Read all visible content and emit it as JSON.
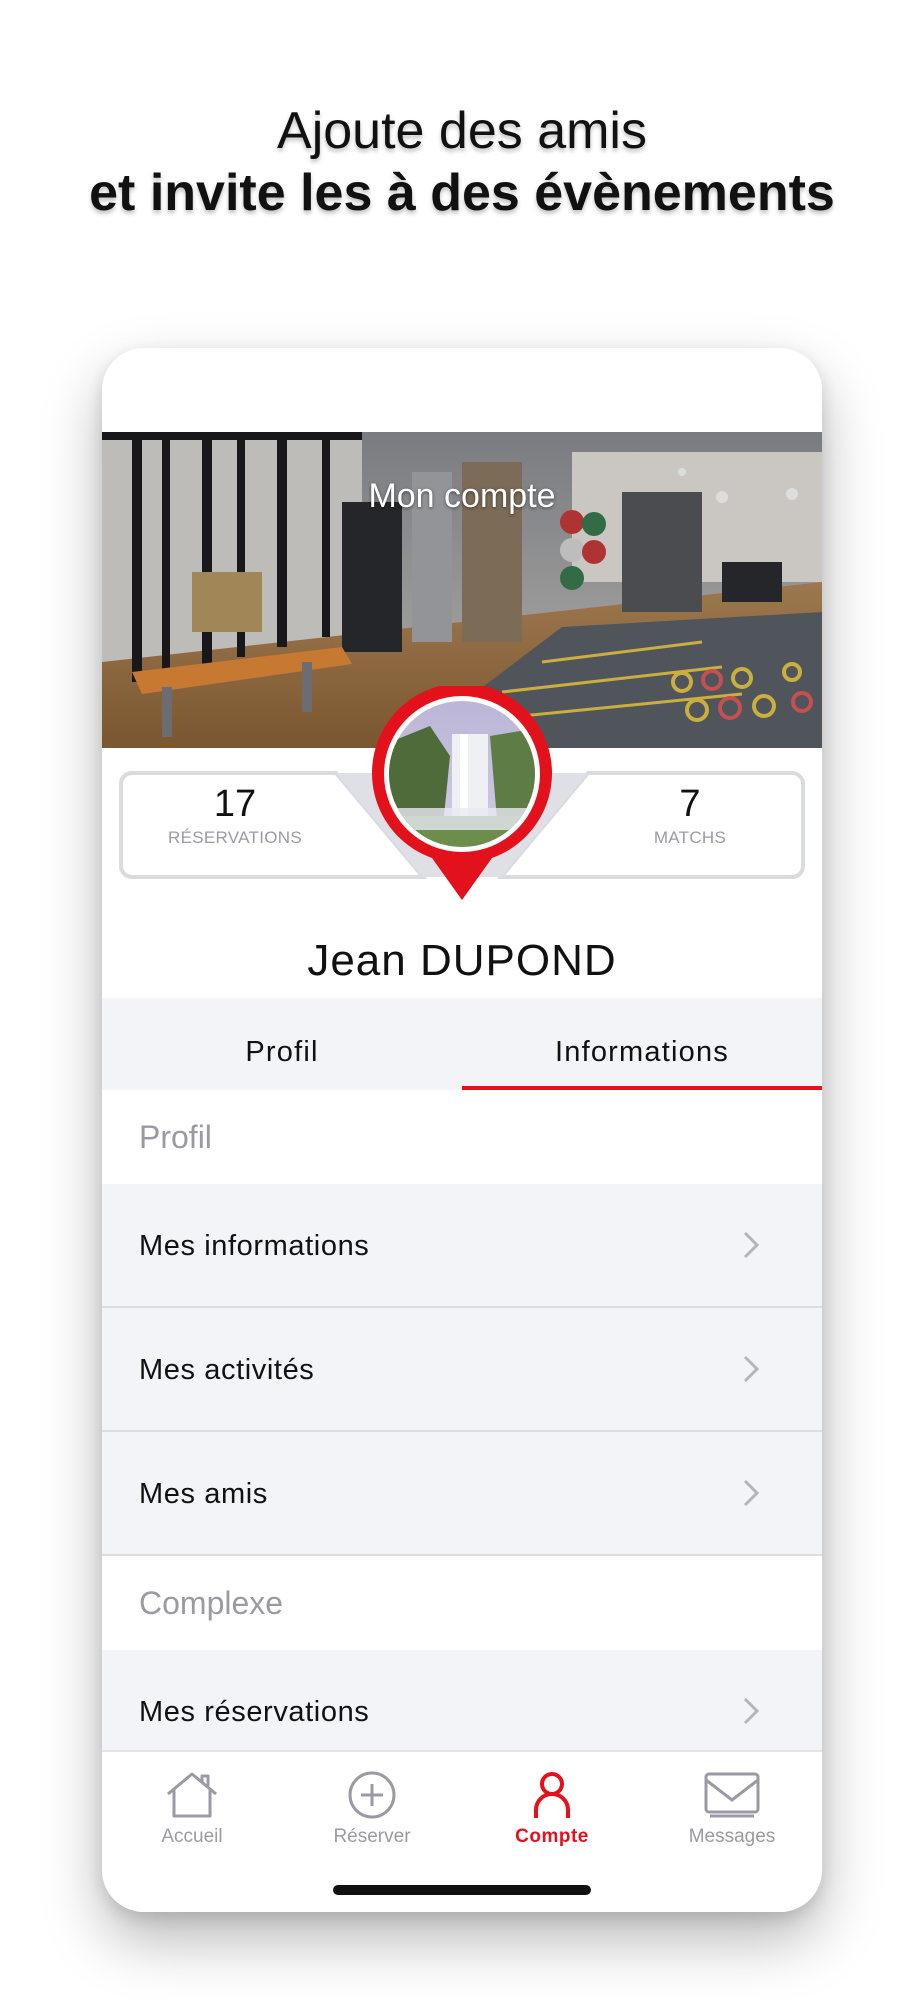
{
  "headline": {
    "line1": "Ajoute des amis",
    "line2": "et invite les à des évènements"
  },
  "header": {
    "title": "Mon compte"
  },
  "stats": {
    "left": {
      "value": "17",
      "label": "RÉSERVATIONS"
    },
    "right": {
      "value": "7",
      "label": "MATCHS"
    }
  },
  "user": {
    "first_name": "Jean",
    "last_name": "DUPOND"
  },
  "tabs": [
    {
      "label": "Profil",
      "active": false
    },
    {
      "label": "Informations",
      "active": true
    }
  ],
  "sections": [
    {
      "title": "Profil",
      "items": [
        {
          "label": "Mes informations"
        },
        {
          "label": "Mes activités"
        },
        {
          "label": "Mes amis"
        }
      ]
    },
    {
      "title": "Complexe",
      "items": [
        {
          "label": "Mes réservations"
        }
      ]
    }
  ],
  "bottom_nav": [
    {
      "label": "Accueil",
      "icon": "home-icon",
      "active": false
    },
    {
      "label": "Réserver",
      "icon": "plus-circle-icon",
      "active": false
    },
    {
      "label": "Compte",
      "icon": "user-icon",
      "active": true
    },
    {
      "label": "Messages",
      "icon": "mail-icon",
      "active": false
    }
  ],
  "colors": {
    "accent": "#e3111b",
    "muted": "#9a9aa4",
    "row_background": "#f3f4f7",
    "text": "#111111"
  }
}
